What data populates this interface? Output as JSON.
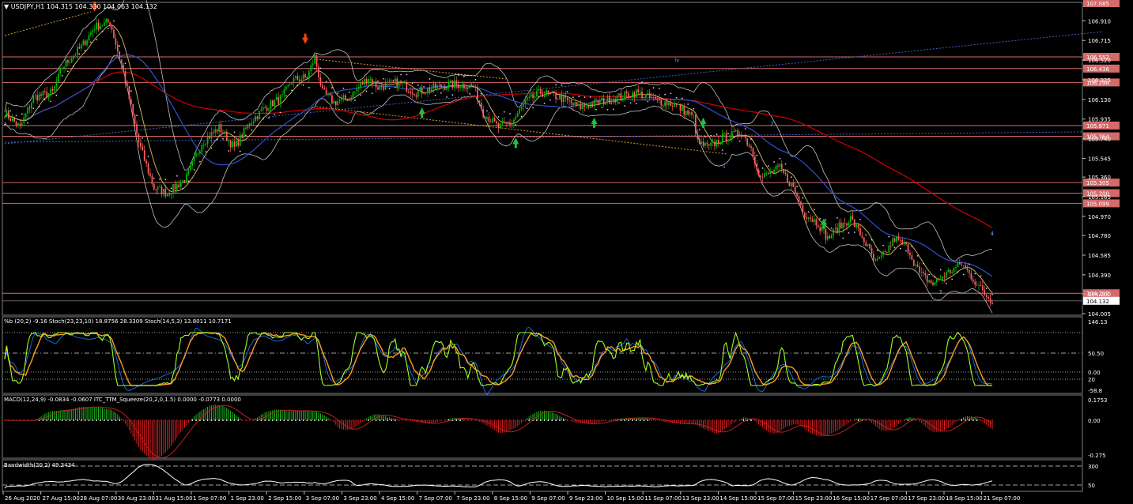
{
  "window": {
    "title": "▼ USDJPY,H1  104.315 104.330 104.063 104.132"
  },
  "colors": {
    "background": "#000000",
    "up_candle": "#00c000",
    "down_candle": "#ff6060",
    "level_line": "#d46a6a",
    "price_tag": "#d46a6a",
    "bollinger": "#c0c0c0",
    "ma_slow": "#d00000",
    "ma_mid": "#3050d0",
    "ma_fast": "#d0c060",
    "psar": "#e0c0ff",
    "arrow_sell": "#ff4010",
    "arrow_buy": "#20c040",
    "stoch_main": "#a0ff20",
    "stoch_signal": "#ff9a20",
    "pctb": "#2080ff",
    "macd_up": "#20c020",
    "macd_down": "#e02020",
    "macd_signal": "#c02020",
    "bandwidth": "#ffffff"
  },
  "price_axis": {
    "labels": [
      "106.910",
      "106.715",
      "106.520",
      "106.325",
      "106.130",
      "105.935",
      "105.740",
      "105.545",
      "105.360",
      "105.165",
      "104.970",
      "104.780",
      "104.585",
      "104.390",
      "104.200",
      "104.005"
    ],
    "top_tag": "107.085",
    "current_tag": "104.132"
  },
  "levels": [
    "106.552",
    "106.436",
    "106.298",
    "105.871",
    "105.764",
    "105.305",
    "105.200",
    "105.099",
    "104.207"
  ],
  "wave_labels": [
    "iv",
    "1",
    "2",
    "3",
    "4"
  ],
  "time_axis": [
    "26 Aug 2020",
    "27 Aug 15:00",
    "28 Aug 07:00",
    "30 Aug 23:00",
    "31 Aug 15:00",
    "1 Sep 07:00",
    "1 Sep 23:00",
    "2 Sep 15:00",
    "3 Sep 07:00",
    "3 Sep 23:00",
    "4 Sep 15:00",
    "7 Sep 07:00",
    "7 Sep 23:00",
    "8 Sep 15:00",
    "9 Sep 07:00",
    "9 Sep 23:00",
    "10 Sep 15:00",
    "11 Sep 07:00",
    "13 Sep 23:00",
    "14 Sep 15:00",
    "15 Sep 07:00",
    "15 Sep 23:00",
    "16 Sep 15:00",
    "17 Sep 07:00",
    "17 Sep 23:00",
    "18 Sep 15:00",
    "21 Sep 07:00"
  ],
  "panels": {
    "osc": {
      "title": "%b (20,2) -9.16  Stoch(23,23,10) 18.8756 28.3309  Stoch(14,5,3) 13.8011 10.7171",
      "labels": [
        "146.13",
        "50.50",
        "0.00",
        "20",
        "-58.8"
      ]
    },
    "macd": {
      "title": "MACD(12,24,9) -0.0834 -0.0607  ITC_TTM_Squeeze(20,2,0,1.5) 0.0000 -0.0773 0.0000",
      "labels": [
        "0.1753",
        "0.00",
        "-0.275"
      ]
    },
    "bw": {
      "title": "Bandwidth(20,2) 49.3434",
      "labels": [
        "300",
        "50"
      ]
    }
  },
  "chart_data": {
    "type": "candlestick",
    "symbol": "USDJPY",
    "timeframe": "H1",
    "ohlc_last": {
      "open": 104.315,
      "high": 104.33,
      "low": 104.063,
      "close": 104.132
    },
    "ylim": [
      104.005,
      107.085
    ],
    "close_path": [
      [
        0,
        106.0
      ],
      [
        8,
        105.85
      ],
      [
        15,
        106.15
      ],
      [
        25,
        106.2
      ],
      [
        30,
        106.45
      ],
      [
        40,
        106.65
      ],
      [
        47,
        106.85
      ],
      [
        55,
        106.9
      ],
      [
        62,
        106.4
      ],
      [
        70,
        105.7
      ],
      [
        78,
        105.25
      ],
      [
        85,
        105.2
      ],
      [
        95,
        105.35
      ],
      [
        103,
        105.7
      ],
      [
        112,
        105.85
      ],
      [
        120,
        105.65
      ],
      [
        128,
        105.9
      ],
      [
        136,
        106.05
      ],
      [
        145,
        106.15
      ],
      [
        150,
        106.32
      ],
      [
        158,
        106.35
      ],
      [
        162,
        106.55
      ],
      [
        166,
        106.2
      ],
      [
        172,
        106.1
      ],
      [
        180,
        106.15
      ],
      [
        190,
        106.35
      ],
      [
        195,
        106.25
      ],
      [
        205,
        106.3
      ],
      [
        215,
        106.2
      ],
      [
        225,
        106.25
      ],
      [
        235,
        106.28
      ],
      [
        245,
        106.26
      ],
      [
        250,
        106.0
      ],
      [
        258,
        105.85
      ],
      [
        265,
        105.9
      ],
      [
        272,
        106.1
      ],
      [
        280,
        106.2
      ],
      [
        290,
        106.15
      ],
      [
        300,
        106.05
      ],
      [
        310,
        106.1
      ],
      [
        320,
        106.15
      ],
      [
        330,
        106.2
      ],
      [
        340,
        106.12
      ],
      [
        350,
        106.08
      ],
      [
        360,
        105.95
      ],
      [
        362,
        105.7
      ],
      [
        368,
        105.65
      ],
      [
        375,
        105.75
      ],
      [
        385,
        105.8
      ],
      [
        390,
        105.65
      ],
      [
        395,
        105.35
      ],
      [
        405,
        105.45
      ],
      [
        412,
        105.25
      ],
      [
        418,
        105.0
      ],
      [
        425,
        104.9
      ],
      [
        430,
        104.75
      ],
      [
        435,
        104.85
      ],
      [
        442,
        104.95
      ],
      [
        450,
        104.7
      ],
      [
        455,
        104.5
      ],
      [
        460,
        104.6
      ],
      [
        465,
        104.75
      ],
      [
        472,
        104.65
      ],
      [
        478,
        104.4
      ],
      [
        485,
        104.3
      ],
      [
        492,
        104.4
      ],
      [
        500,
        104.5
      ],
      [
        506,
        104.35
      ],
      [
        512,
        104.2
      ],
      [
        516,
        104.13
      ]
    ],
    "levels": [
      106.552,
      106.436,
      106.298,
      105.871,
      105.764,
      105.305,
      105.2,
      105.099,
      104.207
    ]
  }
}
